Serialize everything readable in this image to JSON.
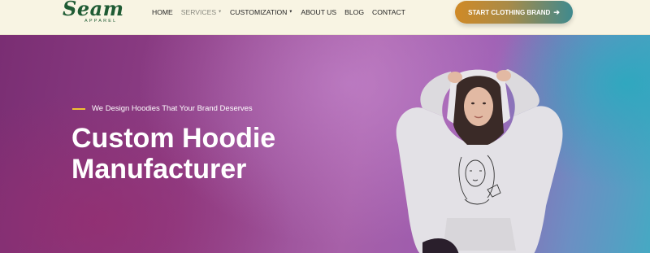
{
  "brand": {
    "name": "Seam",
    "tagline": "APPAREL",
    "color": "#1f5b34"
  },
  "nav": {
    "items": [
      {
        "label": "HOME",
        "has_dropdown": false
      },
      {
        "label": "SERVICES",
        "has_dropdown": true
      },
      {
        "label": "CUSTOMIZATION",
        "has_dropdown": true
      },
      {
        "label": "ABOUT US",
        "has_dropdown": false
      },
      {
        "label": "BLOG",
        "has_dropdown": false
      },
      {
        "label": "CONTACT",
        "has_dropdown": false
      }
    ],
    "dropdown_icon": "caret-down-icon"
  },
  "cta": {
    "label": "START CLOTHING BRAND",
    "icon": "arrow-right-icon",
    "gradient": [
      "#d08a26",
      "#3f8a8e"
    ]
  },
  "hero": {
    "eyebrow": "We Design Hoodies That Your Brand Deserves",
    "title_line1": "Custom Hoodie",
    "title_line2": "Manufacturer",
    "accent_color": "#f1c232",
    "image": "model-in-white-hoodie"
  }
}
